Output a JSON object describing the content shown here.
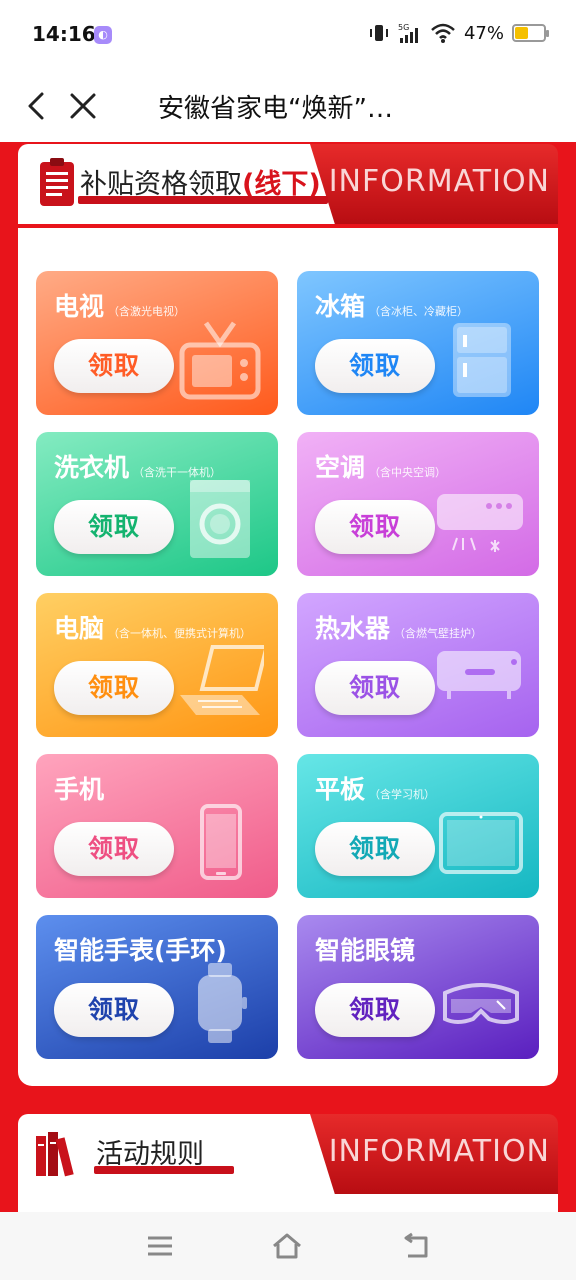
{
  "status": {
    "time": "14:16",
    "battery": "47%",
    "battery_level": 0.47,
    "network": "5G"
  },
  "nav": {
    "title": "安徽省家电“焕新”…"
  },
  "section1": {
    "title_prefix": "补贴资格领取",
    "title_highlight": "(线下)",
    "banner_text": "INFORMATION"
  },
  "cards": [
    {
      "title": "电视",
      "sub": "（含激光电视）",
      "button": "领取",
      "icon": "tv-icon",
      "colors": [
        "#ffab86",
        "#ff5a1c"
      ],
      "btn_color": "#ff5c26"
    },
    {
      "title": "冰箱",
      "sub": "（含冰柜、冷藏柜）",
      "button": "领取",
      "icon": "fridge-icon",
      "colors": [
        "#7fc6ff",
        "#1f86f5"
      ],
      "btn_color": "#1f86f5"
    },
    {
      "title": "洗衣机",
      "sub": "（含洗干一体机）",
      "button": "领取",
      "icon": "washing-machine-icon",
      "colors": [
        "#84ebc1",
        "#1dc787"
      ],
      "btn_color": "#14b36f"
    },
    {
      "title": "空调",
      "sub": "（含中央空调）",
      "button": "领取",
      "icon": "air-conditioner-icon",
      "colors": [
        "#f1b1f6",
        "#d36be6"
      ],
      "btn_color": "#c83fd8"
    },
    {
      "title": "电脑",
      "sub": "（含一体机、便携式计算机）",
      "button": "领取",
      "icon": "laptop-icon",
      "colors": [
        "#ffcf63",
        "#ff9614"
      ],
      "btn_color": "#ff8f10"
    },
    {
      "title": "热水器",
      "sub": "（含燃气壁挂炉）",
      "button": "领取",
      "icon": "water-heater-icon",
      "colors": [
        "#d2a6ff",
        "#a663ef"
      ],
      "btn_color": "#9b52e6"
    },
    {
      "title": "手机",
      "sub": "",
      "button": "领取",
      "icon": "phone-icon",
      "colors": [
        "#ffa4bd",
        "#f05c8a"
      ],
      "btn_color": "#ee4f82"
    },
    {
      "title": "平板",
      "sub": "（含学习机）",
      "button": "领取",
      "icon": "tablet-icon",
      "colors": [
        "#66e6e6",
        "#15b7c2"
      ],
      "btn_color": "#12a9b6"
    },
    {
      "title": "智能手表(手环)",
      "sub": "",
      "button": "领取",
      "icon": "smartwatch-icon",
      "colors": [
        "#5d8fee",
        "#1c3fa9"
      ],
      "btn_color": "#1f43ad"
    },
    {
      "title": "智能眼镜",
      "sub": "",
      "button": "领取",
      "icon": "vr-glasses-icon",
      "colors": [
        "#a98aef",
        "#5a1fbf"
      ],
      "btn_color": "#6122bf"
    }
  ],
  "section2": {
    "title": "活动规则",
    "banner_text": "INFORMATION"
  }
}
